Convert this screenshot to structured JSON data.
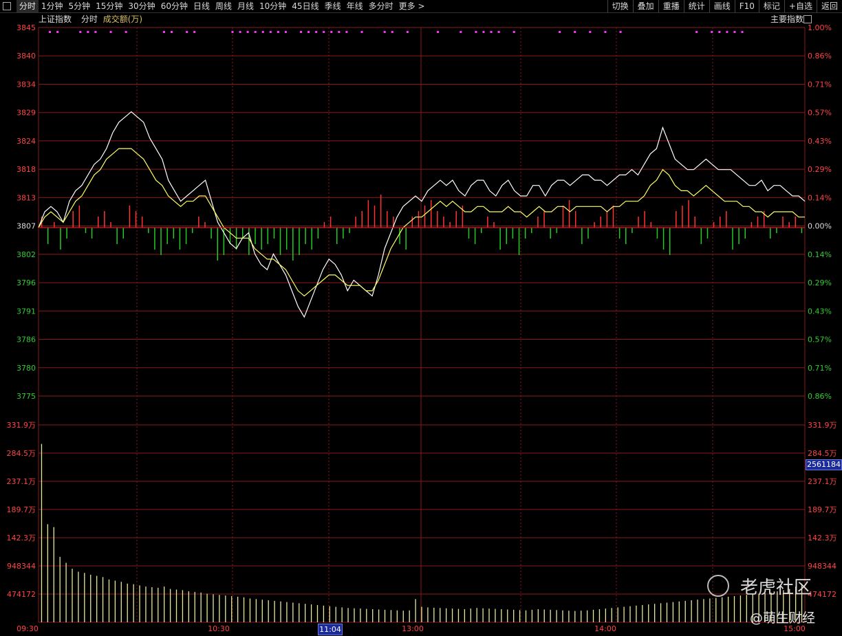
{
  "toolbar": {
    "tabs": [
      "分时",
      "1分钟",
      "5分钟",
      "15分钟",
      "30分钟",
      "60分钟",
      "日线",
      "周线",
      "月线",
      "10分钟",
      "45日线",
      "季线",
      "年线",
      "多分时",
      "更多 >"
    ],
    "right_buttons": [
      "切换",
      "叠加",
      "重播",
      "统计",
      "画线",
      "F10",
      "标记",
      "+自选",
      "返回"
    ]
  },
  "subheader": {
    "index_name": "上证指数",
    "mode": "分时",
    "volume_label": "成交额(万)"
  },
  "indicator_label": "主要指数",
  "time_marker": "11:04",
  "volume_readout": "2561184",
  "watermark": {
    "text": "老虎社区",
    "author": "@萌生财经"
  },
  "colors": {
    "up": "#ff3333",
    "down": "#22cc22",
    "grid": "#8a1a1a",
    "price_line": "#ffffff",
    "avg_line": "#ffff66",
    "volume": "#e8e8a0",
    "signal": "#ff33ff"
  },
  "chart_data": {
    "type": "line",
    "price_axis": {
      "left_ticks": [
        "3845",
        "3840",
        "3834",
        "3829",
        "3824",
        "3818",
        "3813",
        "3807",
        "3802",
        "3796",
        "3791",
        "3786",
        "3780",
        "3775"
      ],
      "right_ticks": [
        "1.00%",
        "0.86%",
        "0.71%",
        "0.57%",
        "0.43%",
        "0.29%",
        "0.14%",
        "0.00%",
        "0.14%",
        "0.29%",
        "0.43%",
        "0.57%",
        "0.71%",
        "0.86%"
      ],
      "base": 3807,
      "ylim": [
        3775,
        3845
      ]
    },
    "volume_axis": {
      "ticks": [
        "331.9万",
        "284.5万",
        "237.1万",
        "189.7万",
        "142.3万",
        "948344",
        "474172"
      ],
      "ylim": [
        0,
        3319000
      ]
    },
    "x_ticks": [
      "09:30",
      "10:30",
      "11:04",
      "13:00",
      "14:00",
      "15:00"
    ],
    "series": [
      {
        "values": [
          3807,
          3810,
          3811,
          3810,
          3808,
          3812,
          3814,
          3815,
          3817,
          3819,
          3820,
          3822,
          3825,
          3827,
          3828,
          3829,
          3828,
          3827,
          3824,
          3822,
          3820,
          3816,
          3814,
          3812,
          3813,
          3814,
          3815,
          3816,
          3812,
          3808,
          3806,
          3804,
          3803,
          3805,
          3806,
          3802,
          3800,
          3799,
          3802,
          3800,
          3798,
          3795,
          3792,
          3790,
          3793,
          3796,
          3799,
          3801,
          3800,
          3798,
          3795,
          3797,
          3796,
          3795,
          3794,
          3798,
          3803,
          3806,
          3809,
          3811,
          3812,
          3813,
          3812,
          3814,
          3815,
          3816,
          3815,
          3816,
          3814,
          3813,
          3815,
          3816,
          3816,
          3814,
          3813,
          3815,
          3816,
          3814,
          3813,
          3813,
          3815,
          3815,
          3813,
          3815,
          3816,
          3816,
          3815,
          3816,
          3817,
          3817,
          3816,
          3816,
          3815,
          3816,
          3817,
          3817,
          3818,
          3817,
          3819,
          3821,
          3822,
          3826,
          3823,
          3820,
          3819,
          3818,
          3818,
          3819,
          3820,
          3819,
          3818,
          3818,
          3818,
          3817,
          3816,
          3815,
          3815,
          3816,
          3814,
          3815,
          3815,
          3814,
          3813,
          3813,
          3812
        ]
      },
      {
        "values": [
          3807,
          3809,
          3810,
          3809,
          3808,
          3810,
          3812,
          3813,
          3815,
          3817,
          3818,
          3820,
          3821,
          3822,
          3822,
          3822,
          3821,
          3820,
          3818,
          3816,
          3815,
          3813,
          3812,
          3811,
          3812,
          3812,
          3813,
          3813,
          3811,
          3809,
          3807,
          3806,
          3805,
          3805,
          3805,
          3803,
          3802,
          3801,
          3801,
          3800,
          3799,
          3797,
          3795,
          3794,
          3795,
          3796,
          3797,
          3798,
          3798,
          3797,
          3796,
          3796,
          3796,
          3795,
          3795,
          3797,
          3800,
          3803,
          3805,
          3807,
          3808,
          3809,
          3809,
          3810,
          3811,
          3812,
          3811,
          3812,
          3811,
          3810,
          3810,
          3811,
          3811,
          3810,
          3810,
          3810,
          3811,
          3810,
          3810,
          3809,
          3810,
          3811,
          3810,
          3810,
          3811,
          3811,
          3810,
          3811,
          3811,
          3811,
          3811,
          3811,
          3810,
          3811,
          3811,
          3812,
          3812,
          3812,
          3813,
          3815,
          3816,
          3818,
          3817,
          3815,
          3814,
          3814,
          3813,
          3814,
          3815,
          3814,
          3813,
          3812,
          3812,
          3812,
          3811,
          3811,
          3810,
          3810,
          3809,
          3810,
          3810,
          3810,
          3810,
          3809,
          3809
        ]
      }
    ],
    "breadth_bars": [
      2,
      -3,
      1,
      -4,
      -2,
      3,
      4,
      -1,
      -2,
      2,
      3,
      1,
      -3,
      -2,
      4,
      3,
      2,
      -1,
      -4,
      -5,
      -3,
      -2,
      -4,
      -3,
      -1,
      2,
      1,
      -2,
      -6,
      -5,
      -3,
      -4,
      -2,
      -5,
      -3,
      -4,
      -3,
      -2,
      -5,
      -4,
      -6,
      -5,
      -3,
      -4,
      -2,
      1,
      2,
      -3,
      -2,
      -1,
      2,
      3,
      5,
      4,
      6,
      3,
      2,
      -3,
      -4,
      2,
      3,
      4,
      5,
      3,
      2,
      1,
      3,
      4,
      -2,
      -3,
      -1,
      2,
      1,
      -4,
      -3,
      -2,
      -5,
      -2,
      -1,
      2,
      3,
      -2,
      -1,
      4,
      5,
      3,
      -3,
      -2,
      1,
      2,
      3,
      4,
      -2,
      -3,
      -1,
      2,
      3,
      1,
      -2,
      -4,
      -5,
      3,
      4,
      5,
      2,
      -3,
      -2,
      1,
      2,
      3,
      -4,
      -3,
      -2,
      1,
      2,
      3,
      -2,
      -1,
      2,
      1,
      2,
      -1
    ],
    "volume_values": [
      3000000,
      1650000,
      1600000,
      1100000,
      1000000,
      900000,
      850000,
      830000,
      800000,
      780000,
      760000,
      720000,
      700000,
      680000,
      650000,
      640000,
      620000,
      600000,
      590000,
      580000,
      600000,
      560000,
      550000,
      540000,
      520000,
      510000,
      500000,
      480000,
      470000,
      460000,
      450000,
      440000,
      430000,
      420000,
      400000,
      390000,
      380000,
      370000,
      360000,
      350000,
      340000,
      330000,
      320000,
      310000,
      300000,
      290000,
      280000,
      270000,
      260000,
      250000,
      240000,
      235000,
      230000,
      225000,
      220000,
      215000,
      210000,
      205000,
      200000,
      195000,
      200000,
      390000,
      260000,
      250000,
      245000,
      240000,
      235000,
      230000,
      225000,
      220000,
      230000,
      240000,
      235000,
      230000,
      225000,
      220000,
      215000,
      210000,
      205000,
      200000,
      210000,
      220000,
      215000,
      210000,
      205000,
      200000,
      195000,
      190000,
      195000,
      200000,
      210000,
      220000,
      230000,
      240000,
      250000,
      260000,
      270000,
      280000,
      290000,
      300000,
      310000,
      320000,
      330000,
      340000,
      350000,
      360000,
      370000,
      380000,
      390000,
      400000,
      410000,
      420000,
      430000,
      440000,
      450000,
      460000,
      470000,
      480000,
      490000,
      500000,
      520000,
      540000,
      560000,
      600000,
      650000
    ],
    "signal_dots": [
      1,
      2,
      5,
      6,
      7,
      9,
      11,
      16,
      17,
      19,
      20,
      25,
      26,
      27,
      28,
      29,
      30,
      31,
      32,
      34,
      35,
      36,
      37,
      38,
      39,
      40,
      42,
      45,
      46,
      48,
      52,
      55,
      57,
      58,
      59,
      60,
      62,
      68,
      70,
      72,
      74,
      76,
      86,
      88,
      89,
      90,
      91,
      92
    ]
  }
}
